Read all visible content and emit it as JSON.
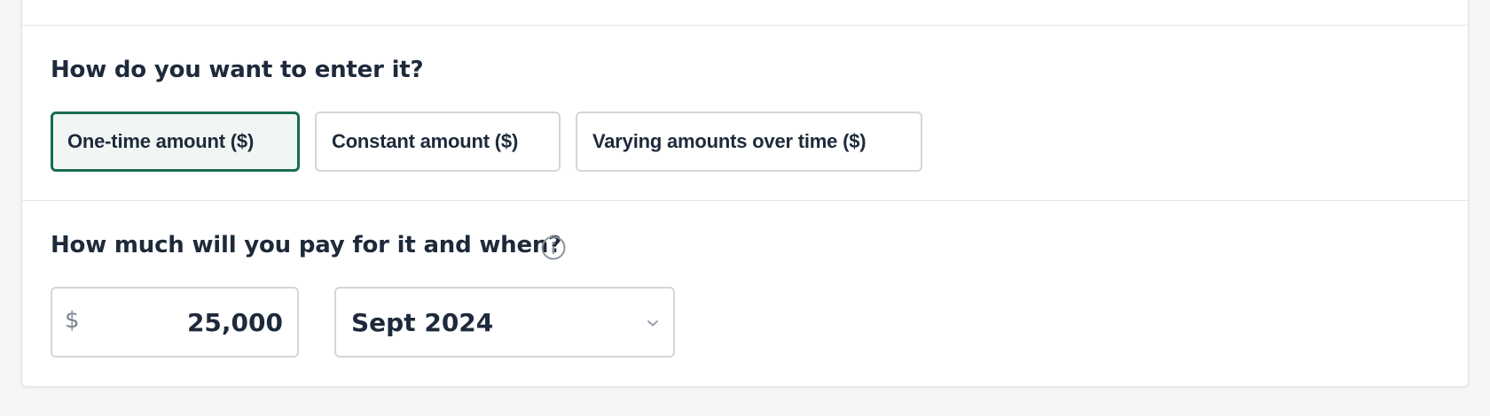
{
  "entry_method": {
    "question": "How do you want to enter it?",
    "options": [
      {
        "label": "One-time amount ($)",
        "selected": true
      },
      {
        "label": "Constant amount ($)",
        "selected": false
      },
      {
        "label": "Varying amounts over time ($)",
        "selected": false
      }
    ]
  },
  "payment": {
    "question": "How much will you pay for it and when?",
    "info_icon": "info-circle-icon",
    "currency_symbol": "$",
    "amount": "25,000",
    "date": "Sept 2024",
    "dropdown_icon": "chevron-down-icon"
  },
  "colors": {
    "selected_border": "#1a6b4f",
    "selected_background": "#f1f6f4",
    "text": "#1e2a3b",
    "border": "#d3d6da"
  }
}
